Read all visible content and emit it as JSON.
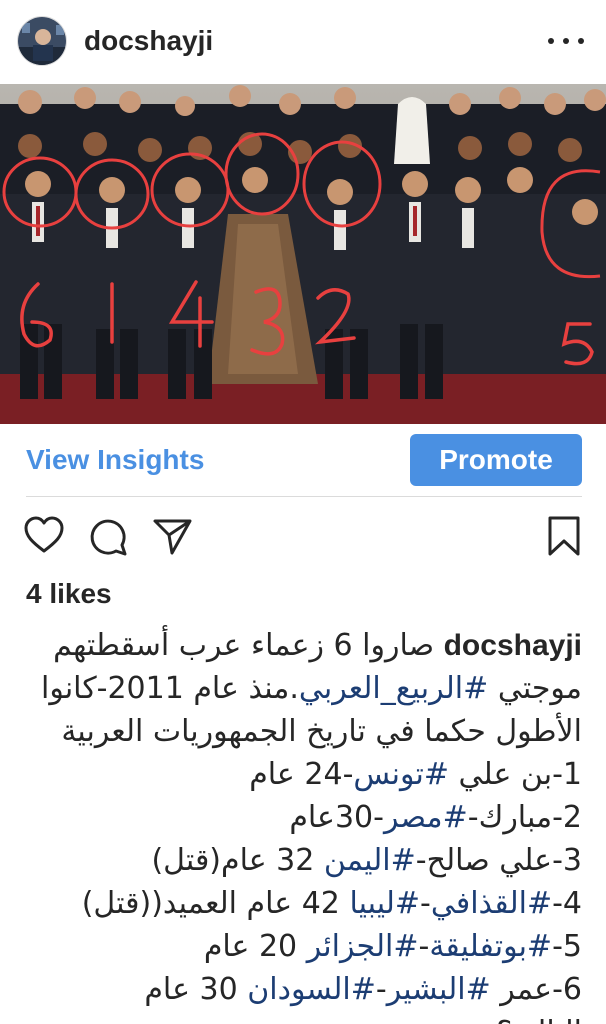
{
  "header": {
    "username": "docshayji",
    "more_icon": "more-horizontal-icon"
  },
  "photo": {
    "annotation_numbers": [
      "6",
      "1",
      "4",
      "3",
      "2",
      "5"
    ],
    "annotation_color": "#e8403f"
  },
  "insights": {
    "view_label": "View Insights",
    "promote_label": "Promote",
    "accent_color": "#4a90e2"
  },
  "actions": {
    "like_icon": "heart-icon",
    "comment_icon": "comment-icon",
    "share_icon": "send-icon",
    "save_icon": "bookmark-icon"
  },
  "likes": "4 likes",
  "caption": {
    "author": "docshayji",
    "line1": "صاروا 6 زعماء عرب أسقطتهم",
    "line2_a": "موجتي ",
    "line2_tag": "#الربيع_العربي",
    "line2_b": ".منذ عام 2011-كانوا",
    "line3": "الأطول حكما في تاريخ الجمهوريات العربية",
    "line4_a": "1-بن علي ",
    "line4_tag": "#تونس",
    "line4_b": "-24 عام",
    "line5_a": "2-مبارك-",
    "line5_tag": "#مصر",
    "line5_b": "-30عام",
    "line6_a": "3-علي صالح-",
    "line6_tag": "#اليمن",
    "line6_b": " 32 عام(قتل)",
    "line7_a": "4-",
    "line7_tag1": "#القذافي",
    "line7_mid": "-",
    "line7_tag2": "#ليبيا",
    "line7_b": " 42 عام العميد((قتل)",
    "line8_a": "5-",
    "line8_tag1": "#بوتفليقة",
    "line8_mid": "-",
    "line8_tag2": "#الجزائر",
    "line8_b": " 20 عام",
    "line9_a": "6-عمر ",
    "line9_tag1": "#البشير",
    "line9_mid": "-",
    "line9_tag2": "#السودان",
    "line9_b": " 30 عام",
    "line10": "التالي؟"
  }
}
